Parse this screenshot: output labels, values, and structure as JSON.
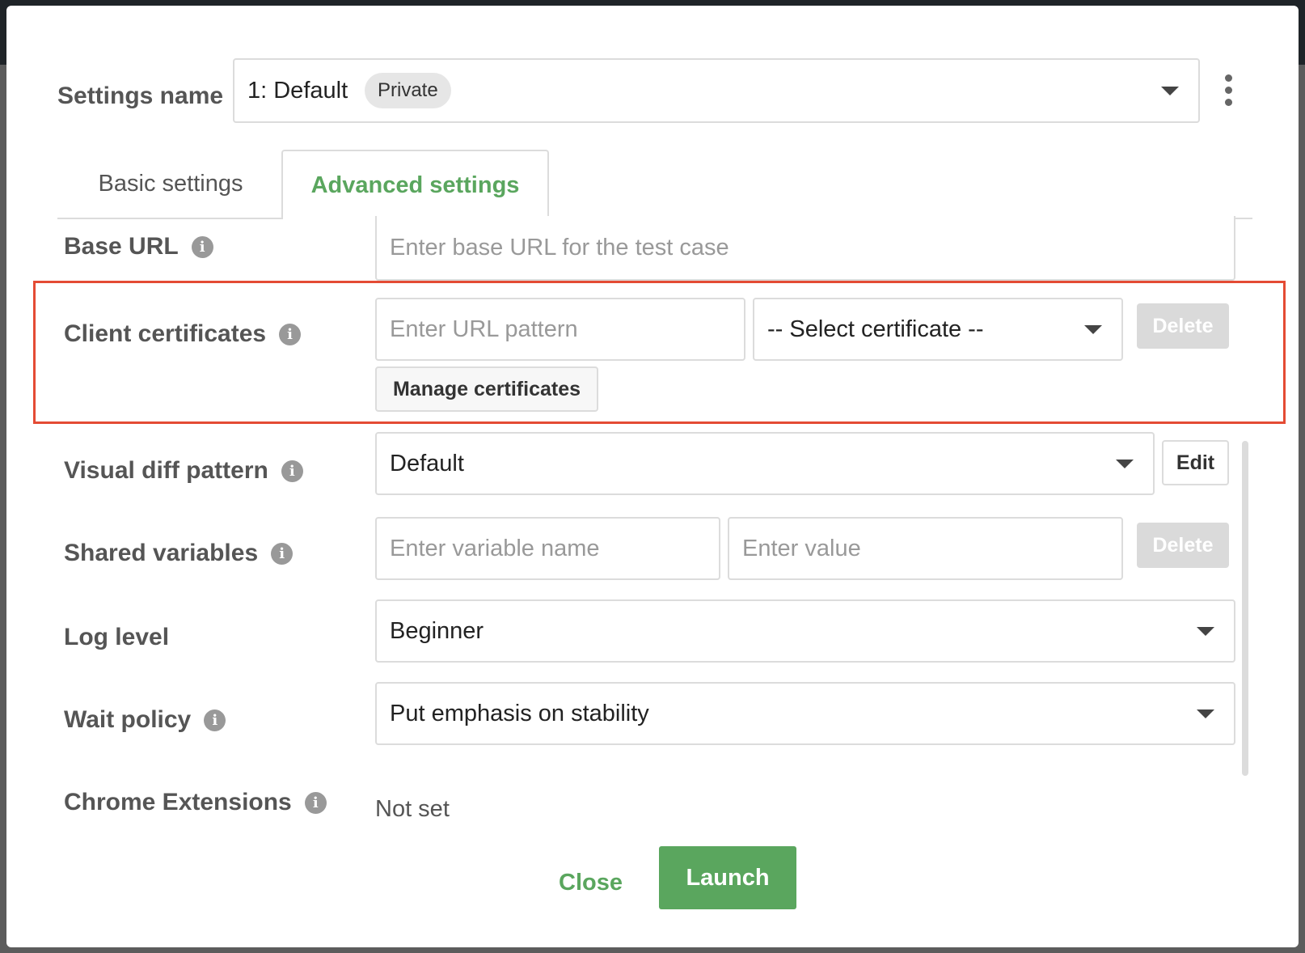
{
  "settings": {
    "label": "Settings name",
    "selected_value": "1: Default",
    "badge": "Private",
    "more_icon": "kebab-icon"
  },
  "tabs": [
    {
      "label": "Basic settings",
      "active": false
    },
    {
      "label": "Advanced settings",
      "active": true
    }
  ],
  "fields": {
    "base_url": {
      "label": "Base URL",
      "placeholder": "Enter base URL for the test case"
    },
    "client_certificates": {
      "label": "Client certificates",
      "url_placeholder": "Enter URL pattern",
      "select_value": "-- Select certificate --",
      "delete_label": "Delete",
      "manage_label": "Manage certificates"
    },
    "visual_diff": {
      "label": "Visual diff pattern",
      "value": "Default",
      "edit_label": "Edit"
    },
    "shared_variables": {
      "label": "Shared variables",
      "name_placeholder": "Enter variable name",
      "value_placeholder": "Enter value",
      "delete_label": "Delete"
    },
    "log_level": {
      "label": "Log level",
      "value": "Beginner"
    },
    "wait_policy": {
      "label": "Wait policy",
      "value": "Put emphasis on stability"
    },
    "chrome_extensions": {
      "label": "Chrome Extensions",
      "value": "Not set"
    }
  },
  "footer": {
    "close_label": "Close",
    "launch_label": "Launch"
  },
  "info_icon_glyph": "i",
  "colors": {
    "accent_green": "#5aa65e",
    "highlight_red": "#e44b34",
    "disabled_gray": "#dadada"
  }
}
